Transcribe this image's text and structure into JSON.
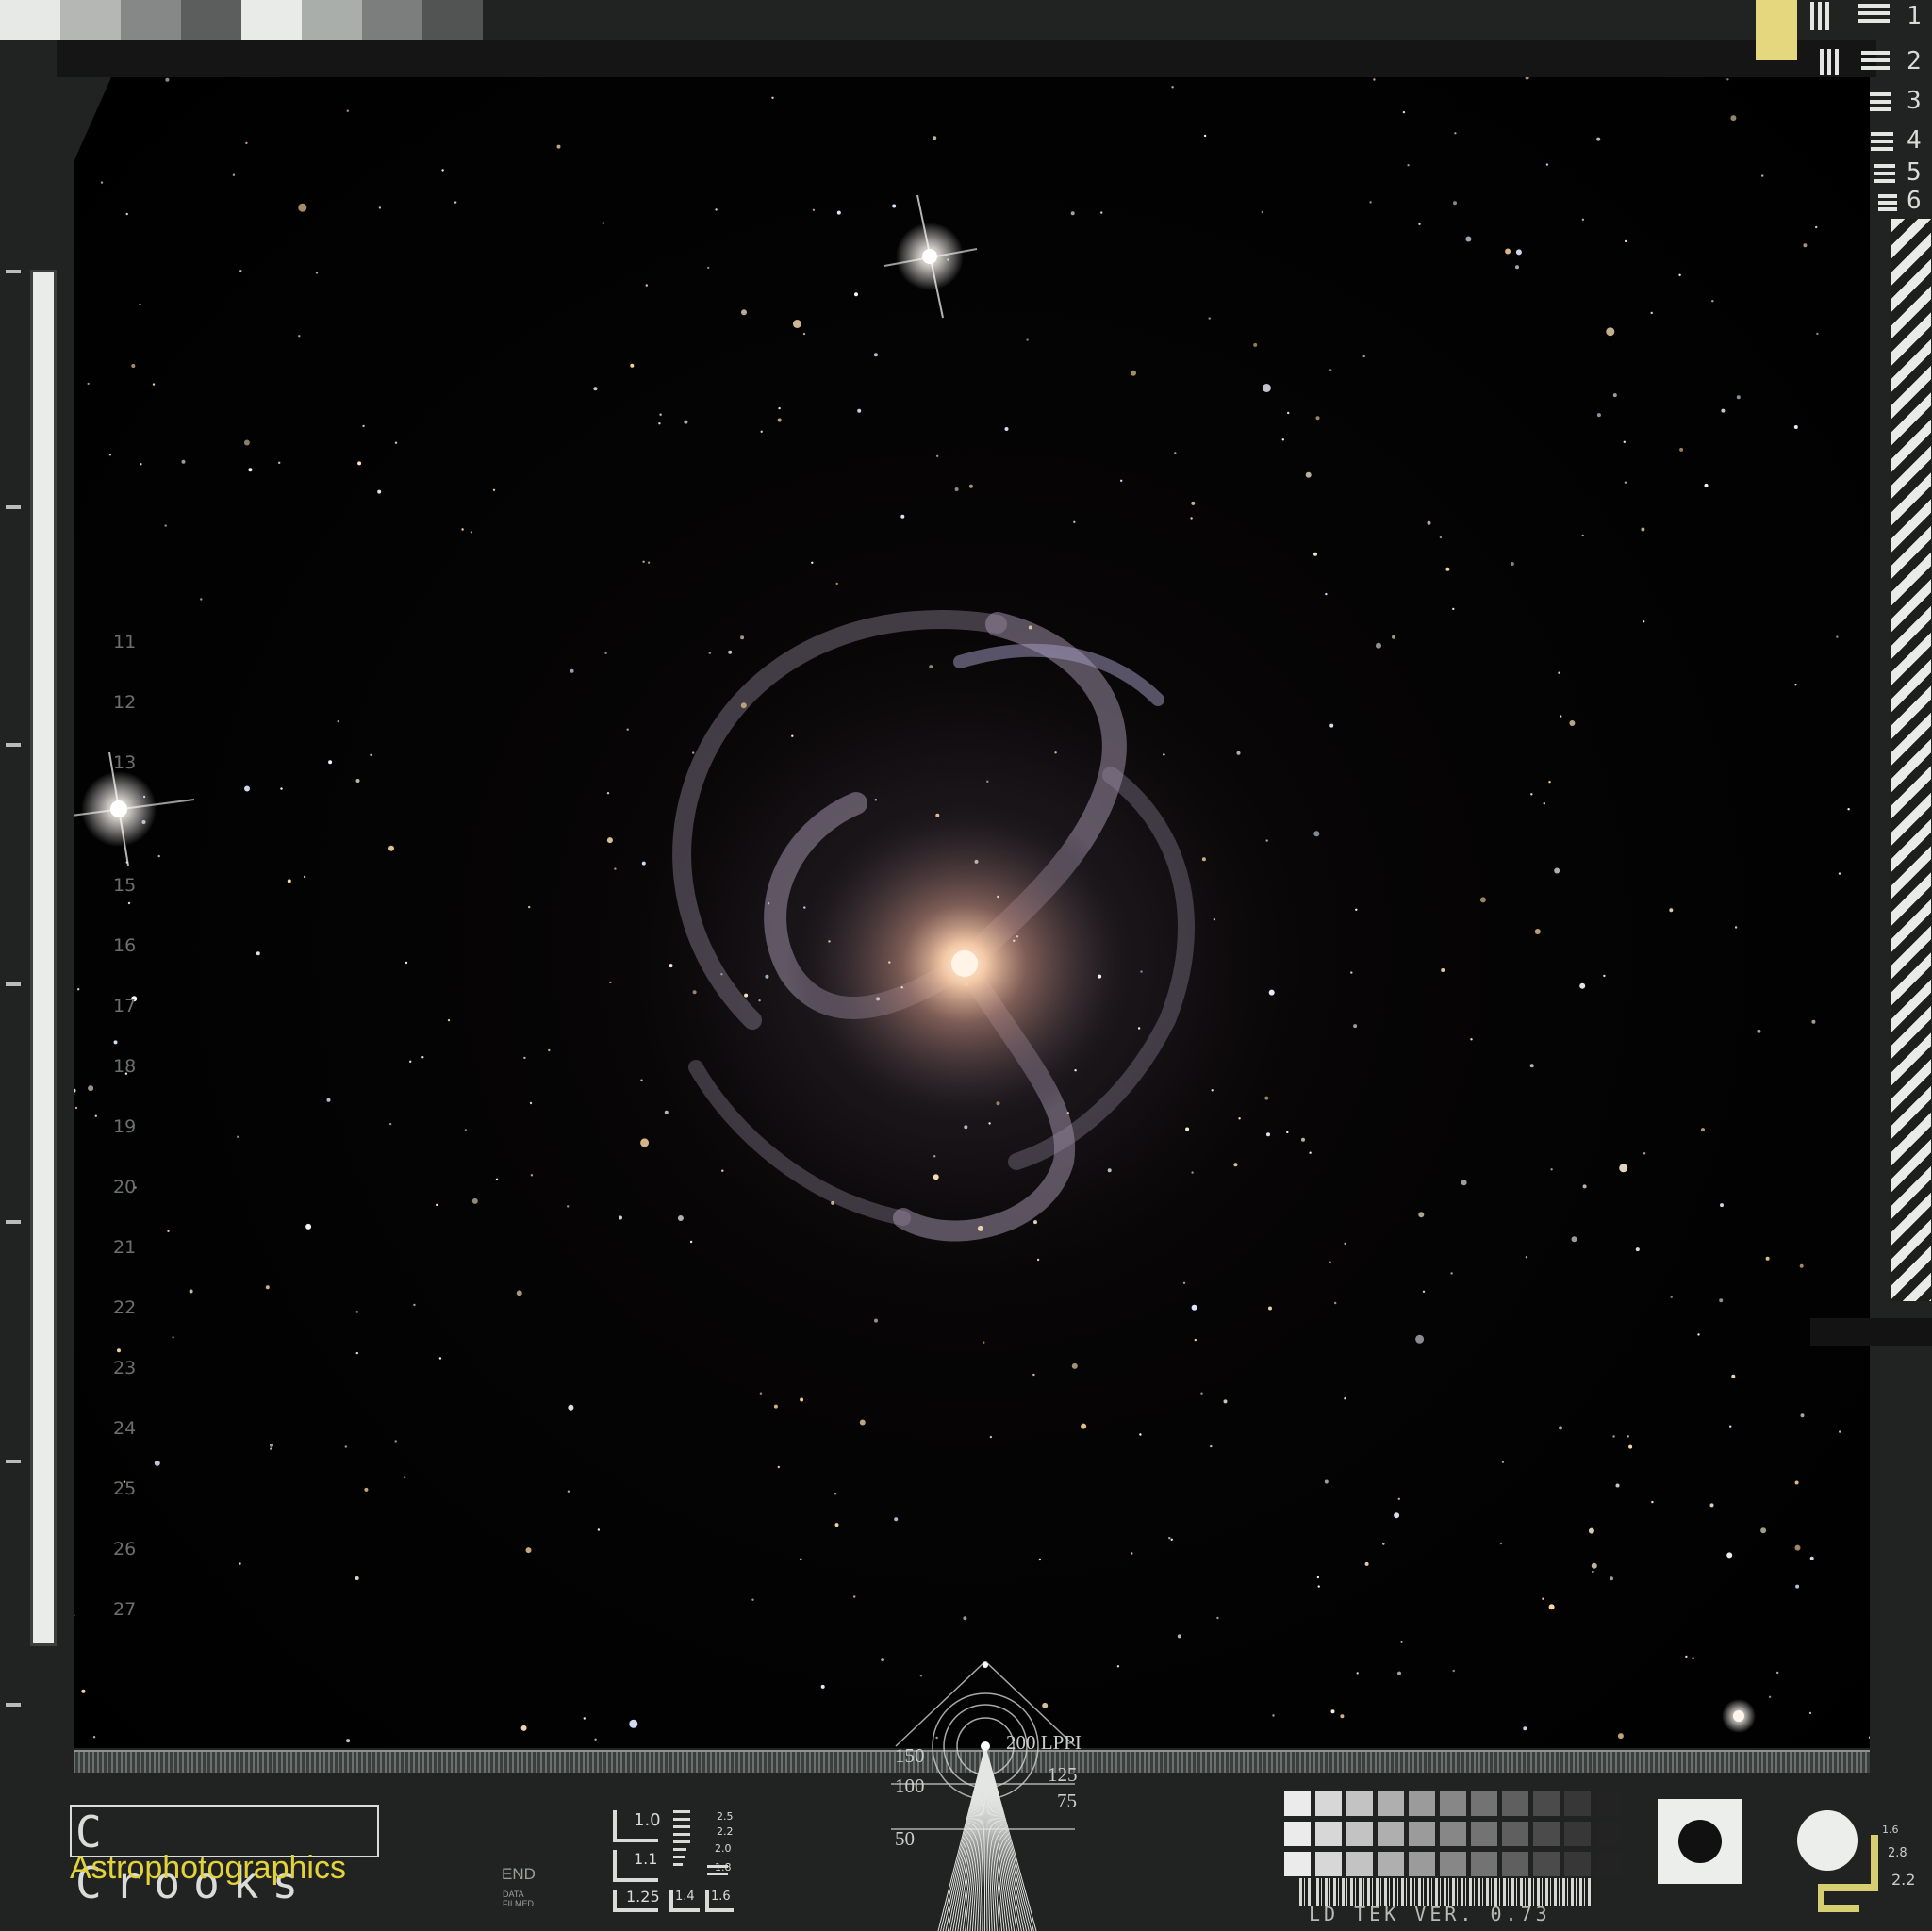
{
  "top_calibration": {
    "patches": [
      "#e7e9e7",
      "#b4b7b4",
      "#858886",
      "#5b5e5c",
      "#e9ebe9",
      "#aaaeab",
      "#7b7e7c",
      "#515452"
    ]
  },
  "resolution_chart": {
    "labels": [
      "1",
      "2",
      "3",
      "4",
      "5",
      "6"
    ],
    "accent": "#e4d77d"
  },
  "scale_labels": [
    "11",
    "12",
    "13",
    "15",
    "16",
    "17",
    "18",
    "19",
    "20",
    "21",
    "22",
    "23",
    "24",
    "25",
    "26",
    "27"
  ],
  "logo": {
    "line1": "C Crooks",
    "line2": "Astrophotographics",
    "line2_color": "#e3d23a"
  },
  "end_marker": {
    "label": "END",
    "sublabel": "DATA FILMED"
  },
  "lens_chart": {
    "labels": [
      "1.0",
      "1.1",
      "1.25",
      "1.4",
      "1.6",
      "1.8",
      "2.0",
      "2.2",
      "2.5"
    ]
  },
  "lppi_chart": {
    "labels": [
      "150",
      "100",
      "50",
      "200 LPPI",
      "125",
      "75"
    ]
  },
  "version_text": "LD TEK VER. 0.73",
  "corner_labels": [
    "1.6",
    "2.8",
    "2.2"
  ],
  "sky": {
    "galaxy_core_color": "#ffd8b8",
    "galaxy_arm_color": "#b49aaa",
    "background": "#000000"
  }
}
